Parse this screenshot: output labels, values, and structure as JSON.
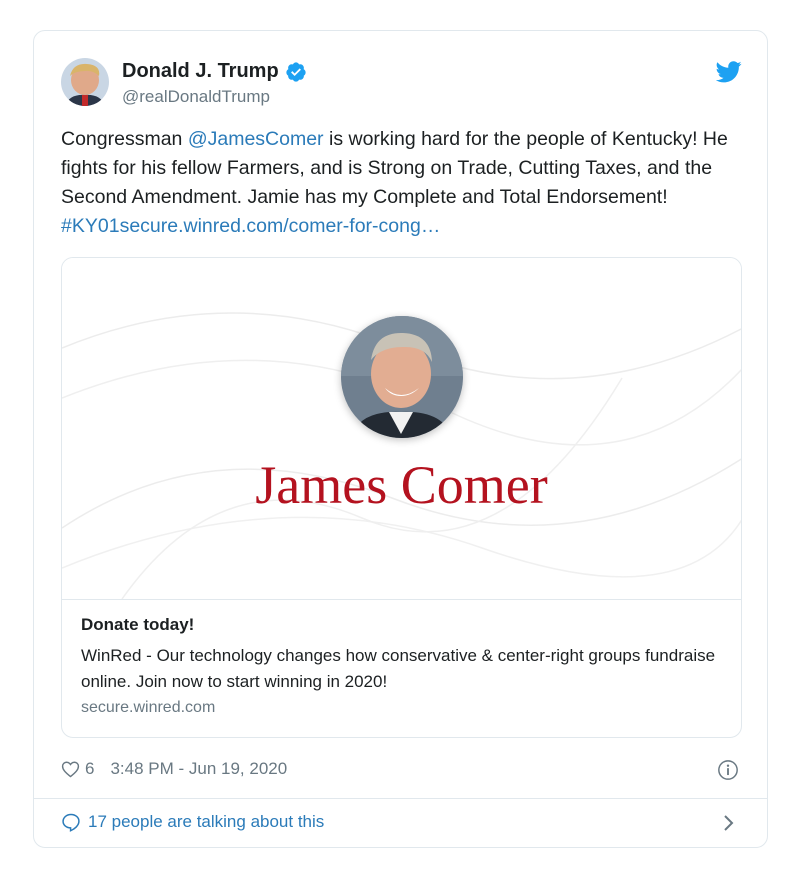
{
  "tweet": {
    "author_name": "Donald J. Trump",
    "author_handle": "@realDonaldTrump",
    "text_parts": [
      {
        "text": "Congressman ",
        "link": false
      },
      {
        "text": "@JamesComer",
        "link": true
      },
      {
        "text": " is working hard for the people of Kentucky! He fights for his fellow Farmers, and is Strong on Trade, Cutting Taxes, and the Second Amendment. Jamie has my Complete and Total Endorsement! ",
        "link": false
      },
      {
        "text": "#KY01",
        "link": true
      },
      {
        "text": "secure.winred.com/comer-for-cong…",
        "link": true
      }
    ],
    "likes": "6",
    "timestamp": "3:48 PM - Jun 19, 2020",
    "talking": "17 people are talking about this"
  },
  "card": {
    "image_name": "James Comer",
    "title": "Donate today!",
    "description": "WinRed - Our technology changes how conservative & center-right groups fundraise online. Join now to start winning in 2020!",
    "domain": "secure.winred.com"
  },
  "colors": {
    "link": "#2b7bb9",
    "name_red": "#b4121f",
    "verified": "#1da1f2",
    "muted": "#697882"
  },
  "icons": [
    "verified-badge-icon",
    "twitter-bird-icon",
    "heart-icon",
    "info-icon",
    "speech-bubble-icon",
    "chevron-right-icon"
  ]
}
